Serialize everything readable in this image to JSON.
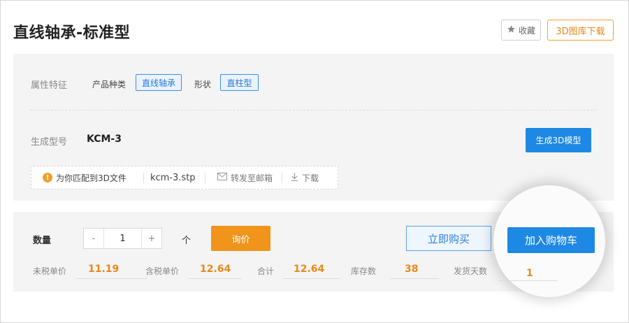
{
  "header": {
    "title": "直线轴承-标准型",
    "favorite_label": "收藏",
    "download_3d_label": "3D图库下载"
  },
  "attributes": {
    "section_label": "属性特征",
    "product_type_label": "产品种类",
    "product_type_value": "直线轴承",
    "shape_label": "形状",
    "shape_value": "直柱型"
  },
  "model": {
    "label": "生成型号",
    "value": "KCM-3",
    "generate_button": "生成3D模型"
  },
  "file_bar": {
    "match_text": "为你匹配到3D文件",
    "file_name": "kcm-3.stp",
    "email_label": "转发至邮箱",
    "download_label": "下载"
  },
  "order": {
    "quantity_label": "数量",
    "decrement": "-",
    "quantity_value": "1",
    "increment": "+",
    "unit": "个",
    "inquiry_button": "询价",
    "buy_now_button": "立即购买",
    "add_to_cart_button": "加入购物车"
  },
  "prices": {
    "untaxed_label": "未税单价",
    "untaxed_value": "11.19",
    "taxed_label": "含税单价",
    "taxed_value": "12.64",
    "total_label": "合计",
    "total_value": "12.64",
    "stock_label": "库存数",
    "stock_value": "38",
    "ship_days_label": "发货天数",
    "ship_days_value": "1"
  },
  "colors": {
    "accent_blue": "#1e88e5",
    "accent_orange": "#f0941c",
    "price_orange": "#e8891a"
  },
  "icons": {
    "favorite": "star-icon",
    "warning": "warning-icon",
    "email": "mail-icon",
    "download": "download-icon"
  }
}
